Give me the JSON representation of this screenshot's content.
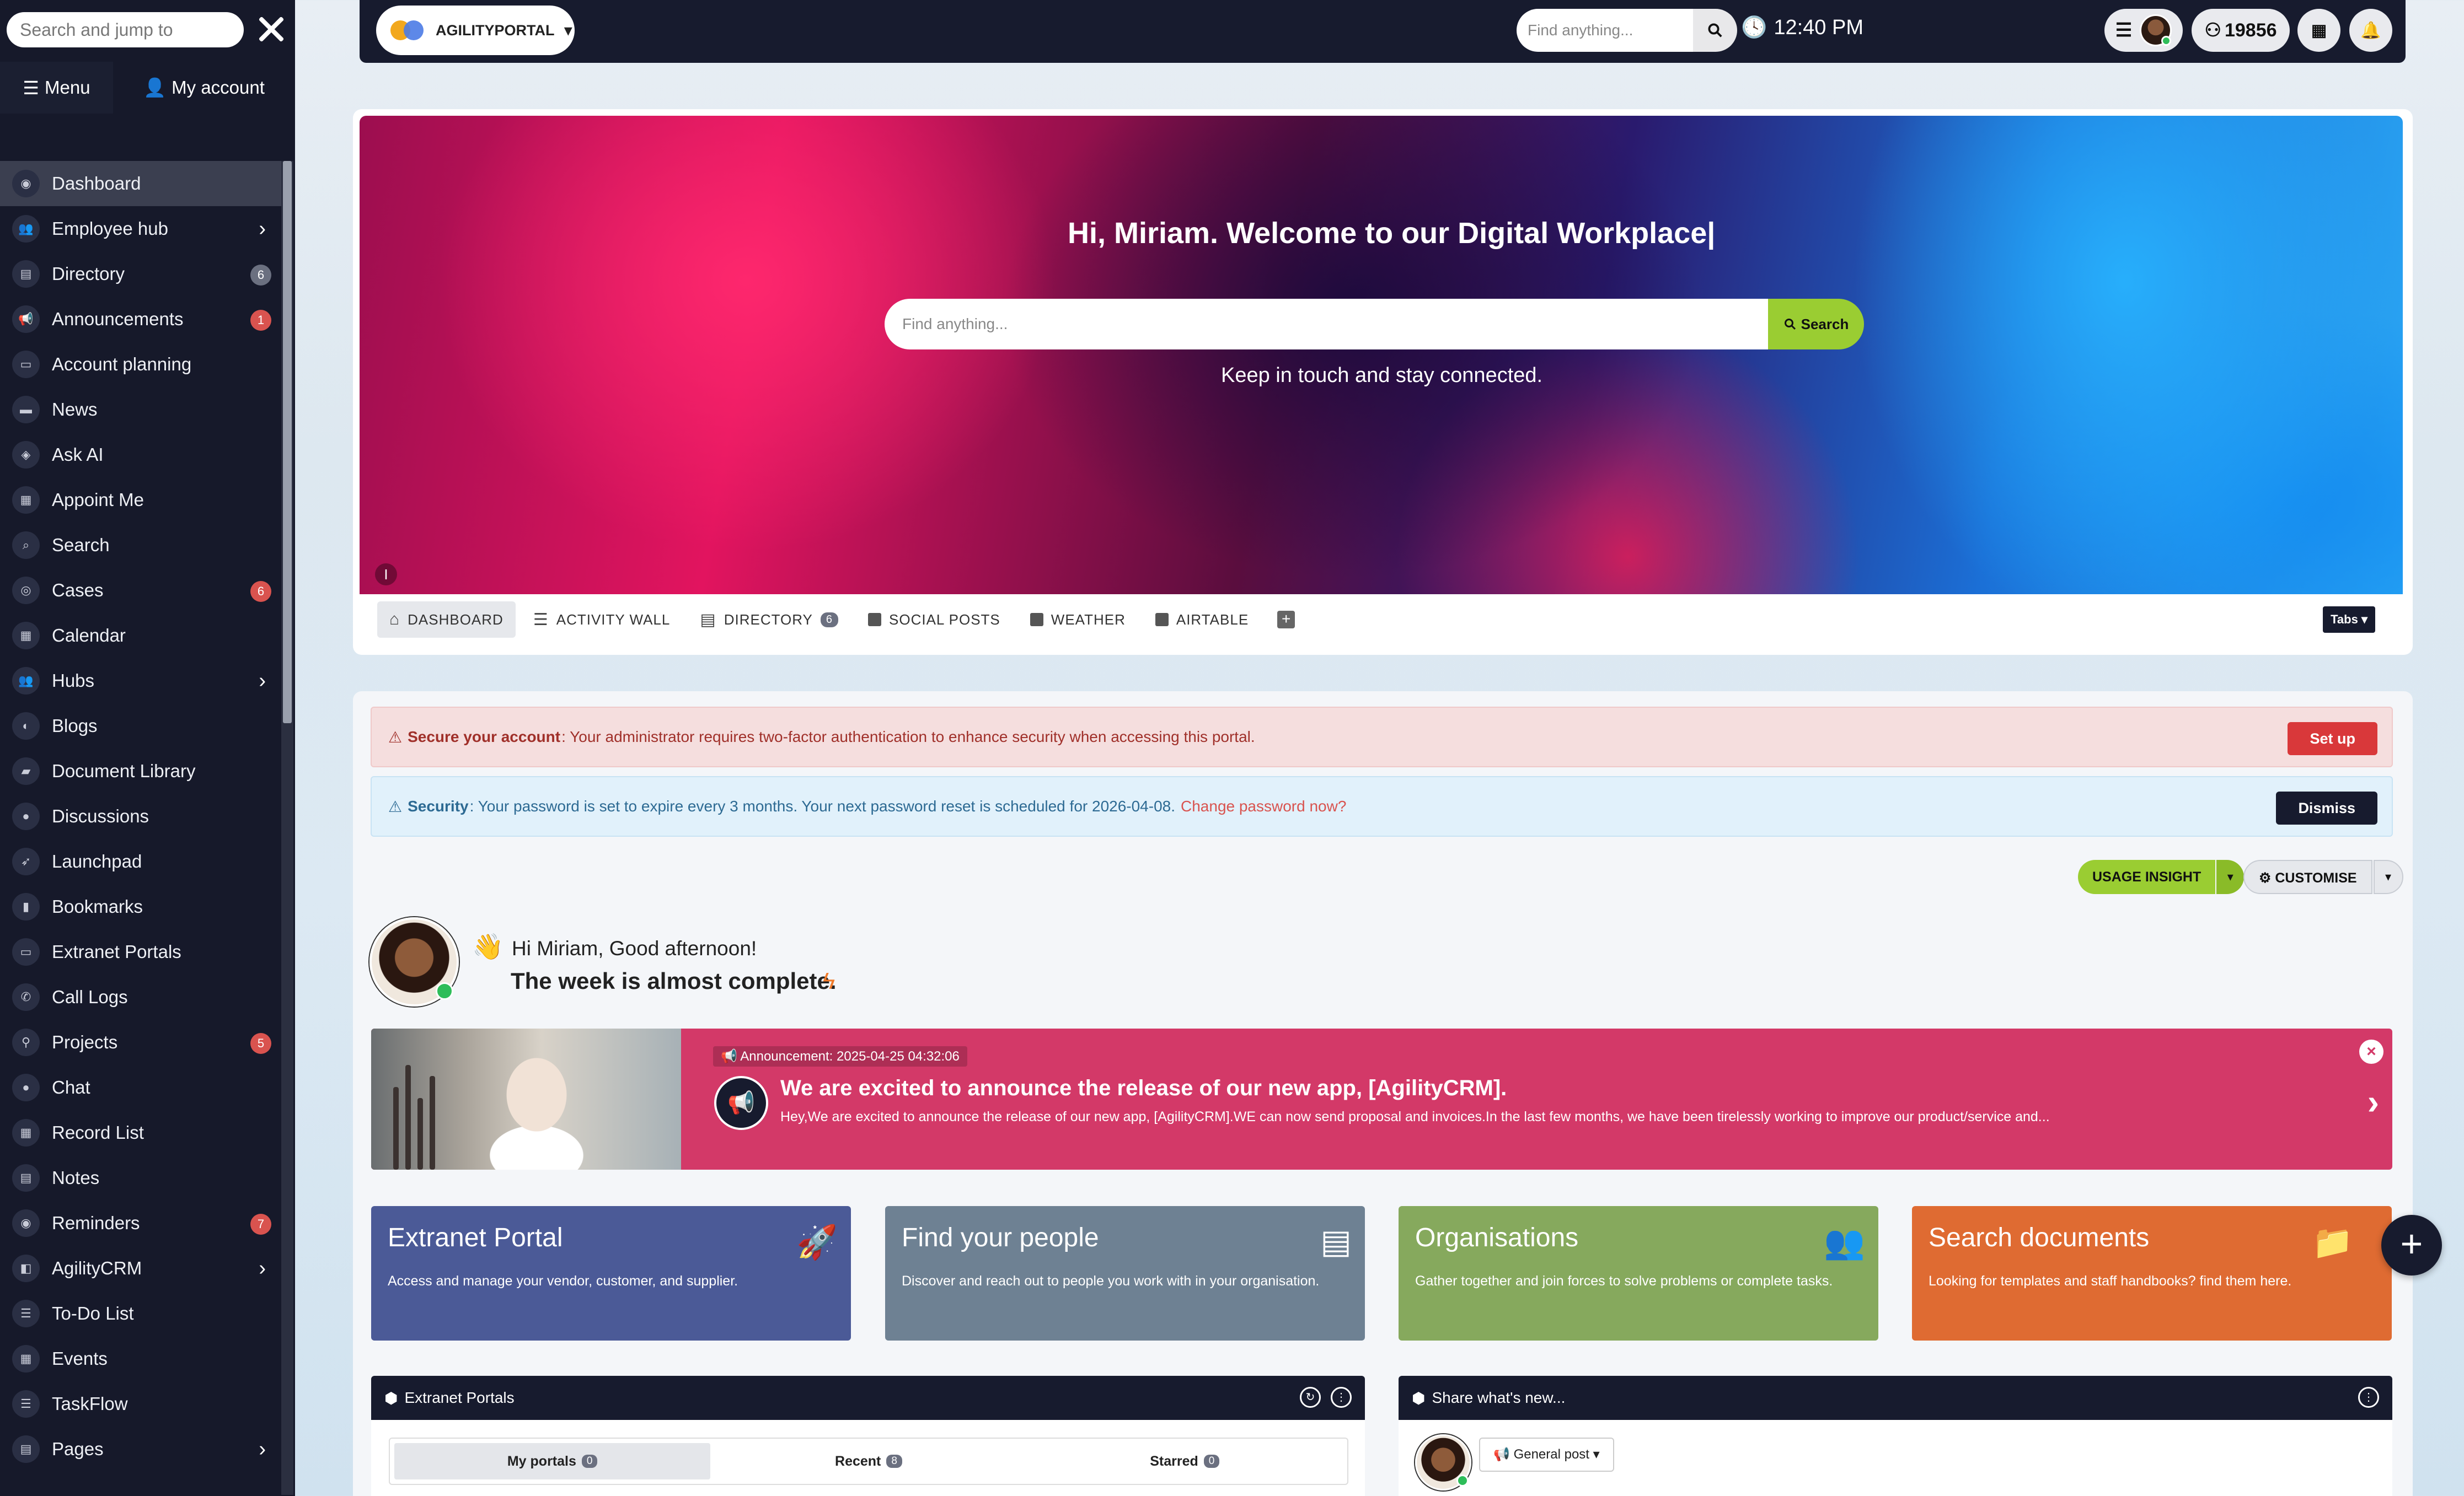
{
  "sidebar": {
    "search_placeholder": "Search and jump to",
    "tabs": {
      "menu": "Menu",
      "account": "My account"
    },
    "items": [
      {
        "label": "Dashboard",
        "icon": "dashboard-icon"
      },
      {
        "label": "Employee hub",
        "icon": "people-icon",
        "chevron": true
      },
      {
        "label": "Directory",
        "icon": "book-icon",
        "badge": "6",
        "badge_style": "gray"
      },
      {
        "label": "Announcements",
        "icon": "megaphone-icon",
        "badge": "1"
      },
      {
        "label": "Account planning",
        "icon": "id-card-icon"
      },
      {
        "label": "News",
        "icon": "newspaper-icon"
      },
      {
        "label": "Ask AI",
        "icon": "robot-icon"
      },
      {
        "label": "Appoint Me",
        "icon": "calendar-check-icon"
      },
      {
        "label": "Search",
        "icon": "search-icon"
      },
      {
        "label": "Cases",
        "icon": "life-ring-icon",
        "badge": "6"
      },
      {
        "label": "Calendar",
        "icon": "calendar-icon"
      },
      {
        "label": "Hubs",
        "icon": "users-icon",
        "chevron": true
      },
      {
        "label": "Blogs",
        "icon": "blog-icon"
      },
      {
        "label": "Document Library",
        "icon": "folder-icon"
      },
      {
        "label": "Discussions",
        "icon": "comment-icon"
      },
      {
        "label": "Launchpad",
        "icon": "rocket-icon"
      },
      {
        "label": "Bookmarks",
        "icon": "bookmark-icon"
      },
      {
        "label": "Extranet Portals",
        "icon": "window-icon"
      },
      {
        "label": "Call Logs",
        "icon": "phone-icon"
      },
      {
        "label": "Projects",
        "icon": "project-icon",
        "badge": "5"
      },
      {
        "label": "Chat",
        "icon": "chat-icon"
      },
      {
        "label": "Record List",
        "icon": "table-icon"
      },
      {
        "label": "Notes",
        "icon": "note-icon"
      },
      {
        "label": "Reminders",
        "icon": "bell-icon",
        "badge": "7"
      },
      {
        "label": "AgilityCRM",
        "icon": "crm-icon",
        "chevron": true
      },
      {
        "label": "To-Do List",
        "icon": "list-icon"
      },
      {
        "label": "Events",
        "icon": "event-icon"
      },
      {
        "label": "TaskFlow",
        "icon": "flow-icon"
      },
      {
        "label": "Pages",
        "icon": "page-icon",
        "chevron": true
      }
    ]
  },
  "topbar": {
    "portal_name": "AGILITYPORTAL",
    "time": "12:40 PM",
    "search_placeholder": "Find anything...",
    "points": "19856"
  },
  "hero": {
    "title": "Hi, Miriam. Welcome to our Digital Workplace|",
    "search_placeholder": "Find anything...",
    "search_button": "Search",
    "subtitle": "Keep in touch and stay connected.",
    "info_mark": "I"
  },
  "tabs": [
    {
      "label": "DASHBOARD",
      "icon": "home-icon",
      "active": true
    },
    {
      "label": "ACTIVITY WALL",
      "icon": "bars-icon"
    },
    {
      "label": "DIRECTORY",
      "icon": "address-book-icon",
      "count": "6"
    },
    {
      "label": "SOCIAL POSTS",
      "icon": "square-icon"
    },
    {
      "label": "WEATHER",
      "icon": "square-icon"
    },
    {
      "label": "AIRTABLE",
      "icon": "square-icon"
    }
  ],
  "tabs_dropdown": "Tabs",
  "alerts": {
    "secure": {
      "title": "Secure your account",
      "text": ": Your administrator requires two-factor authentication to enhance security when accessing this portal.",
      "button": "Set up"
    },
    "security": {
      "title": "Security",
      "text": ": Your password is set to expire every 3 months. Your next password reset is scheduled for 2026-04-08.",
      "link": "Change password now?",
      "button": "Dismiss"
    }
  },
  "actions": {
    "usage_insight": "USAGE INSIGHT",
    "customise": "CUSTOMISE"
  },
  "greeting": {
    "line1": "Hi Miriam, Good afternoon!",
    "line2": "The week is almost complete."
  },
  "announcement": {
    "tag": "Announcement: 2025-04-25 04:32:06",
    "title": "We are excited to announce the release of our new app, [AgilityCRM].",
    "body": "Hey,We are excited to announce the release of our new app, [AgilityCRM].WE can now send proposal and invoices.In the last few months, we have been tirelessly working to improve our product/service and..."
  },
  "tiles": [
    {
      "title": "Extranet Portal",
      "desc": "Access and manage your vendor, customer, and supplier.",
      "icon": "rocket-icon"
    },
    {
      "title": "Find your people",
      "desc": "Discover and reach out to people you work with in your organisation.",
      "icon": "address-book-icon"
    },
    {
      "title": "Organisations",
      "desc": "Gather together and join forces to solve problems or complete tasks.",
      "icon": "users-icon"
    },
    {
      "title": "Search documents",
      "desc": "Looking for templates and staff handbooks? find them here.",
      "icon": "folder-plus-icon"
    }
  ],
  "widgets": {
    "extranet": {
      "title": "Extranet Portals",
      "tabs": [
        {
          "label": "My portals",
          "count": "0"
        },
        {
          "label": "Recent",
          "count": "8"
        },
        {
          "label": "Starred",
          "count": "0"
        }
      ]
    },
    "share": {
      "title": "Share what's new...",
      "post_type": "General post"
    }
  }
}
